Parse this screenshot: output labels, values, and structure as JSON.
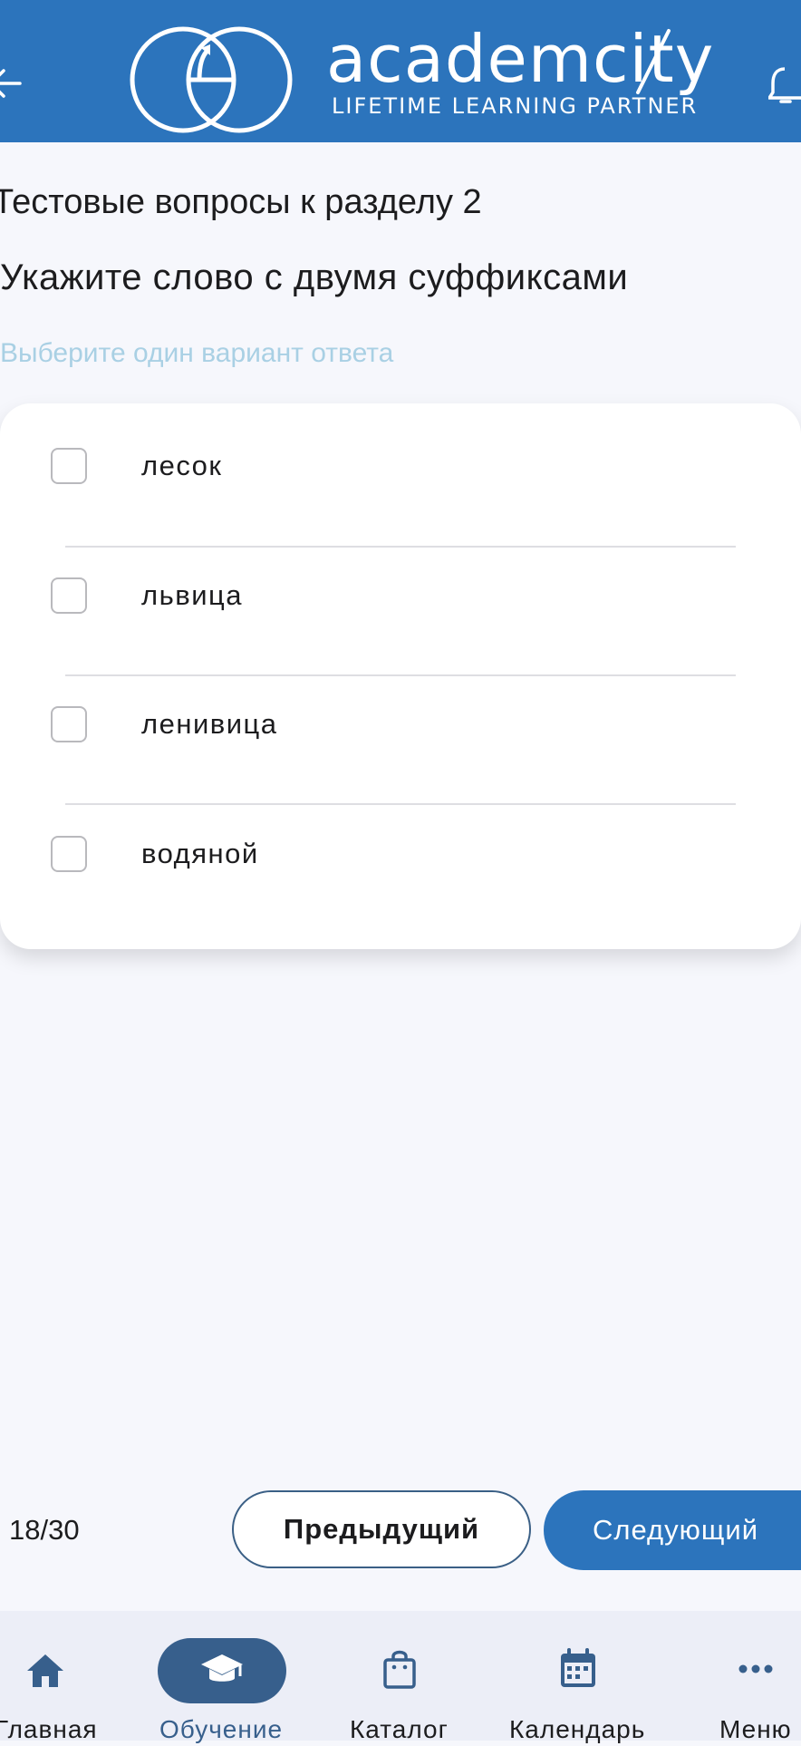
{
  "header": {
    "brand": "academcity",
    "tagline": "LIFETIME LEARNING PARTNER",
    "accent_color": "#2c74bc",
    "back_icon": "arrow-left-icon",
    "notification_icon": "bell-icon"
  },
  "test": {
    "section_title": "Тестовые вопросы к разделу 2",
    "question": "Укажите слово с двумя суффиксами",
    "hint": "Выберите один вариант ответа",
    "options": [
      {
        "label": "лесок",
        "checked": false
      },
      {
        "label": "львица",
        "checked": false
      },
      {
        "label": "ленивица",
        "checked": false
      },
      {
        "label": "водяной",
        "checked": false
      }
    ]
  },
  "pagination": {
    "counter": "18/30",
    "prev_label": "Предыдущий",
    "next_label": "Следующий"
  },
  "nav": {
    "items": [
      {
        "label": "Главная",
        "icon": "home-icon",
        "active": false
      },
      {
        "label": "Обучение",
        "icon": "graduation-cap-icon",
        "active": true
      },
      {
        "label": "Каталог",
        "icon": "shopping-bag-icon",
        "active": false
      },
      {
        "label": "Календарь",
        "icon": "calendar-icon",
        "active": false
      },
      {
        "label": "Меню",
        "icon": "more-dots-icon",
        "active": false
      }
    ],
    "active_color": "#375f8c"
  }
}
